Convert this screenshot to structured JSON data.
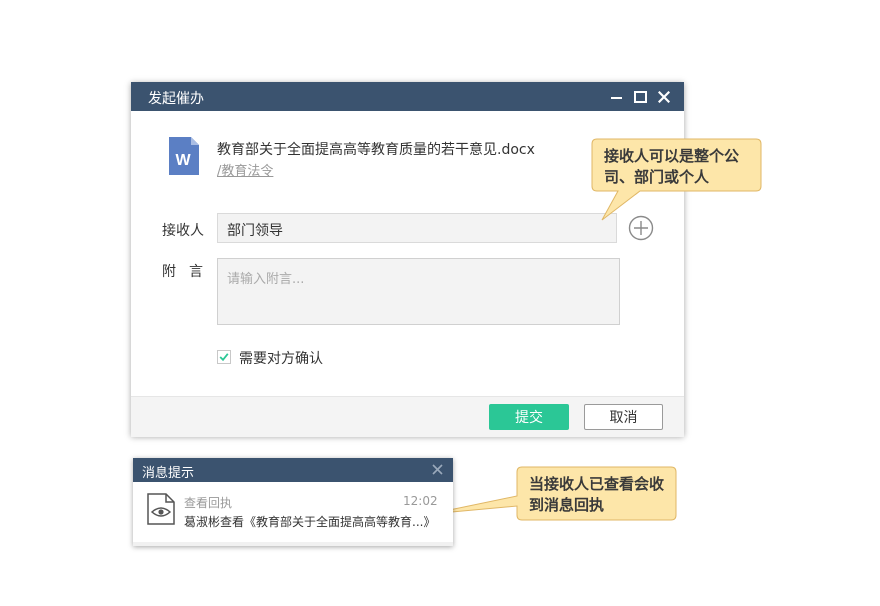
{
  "dialog": {
    "title": "发起催办",
    "file": {
      "icon": "word-doc-icon",
      "icon_letter": "W",
      "name": "教育部关于全面提高高等教育质量的若干意见.docx",
      "path": "/教育法令"
    },
    "recipient": {
      "label": "接收人",
      "value": "部门领导"
    },
    "note": {
      "label": "附言",
      "placeholder": "请输入附言..."
    },
    "confirm": {
      "label": "需要对方确认",
      "checked": true
    },
    "buttons": {
      "submit": "提交",
      "cancel": "取消"
    }
  },
  "callouts": {
    "recipient_hint": "接收人可以是整个公司、部门或个人",
    "receipt_hint": "当接收人已查看会收到消息回执"
  },
  "notification": {
    "title": "消息提示",
    "heading": "查看回执",
    "time": "12:02",
    "message": "葛淑彬查看《教育部关于全面提高高等教育...》"
  },
  "colors": {
    "titlebar": "#3b536f",
    "primary_button": "#2bc796",
    "callout_fill": "#fde6a9",
    "callout_border": "#e0b766",
    "doc_icon": "#5b7fc4"
  }
}
